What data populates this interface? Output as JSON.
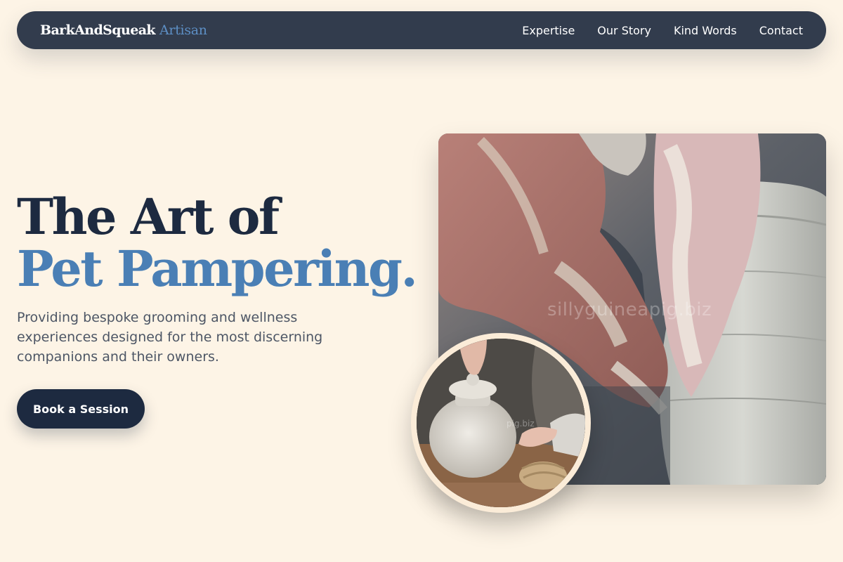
{
  "nav": {
    "brand_name": "BarkAndSqueak",
    "brand_accent": "Artisan",
    "links": [
      "Expertise",
      "Our Story",
      "Kind Words",
      "Contact"
    ]
  },
  "hero": {
    "title_line1": "The Art of",
    "title_line2": "Pet Pampering.",
    "description": "Providing bespoke grooming and wellness experiences designed for the most discerning companions and their owners.",
    "cta_label": "Book a Session"
  },
  "images": {
    "main_watermark": "sillyguineapig.biz",
    "inset_watermark": "pig.biz"
  },
  "colors": {
    "background": "#fdf4e6",
    "nav_bg": "#323c4d",
    "accent_blue": "#4a7fb5",
    "dark_navy": "#1d2a40"
  }
}
